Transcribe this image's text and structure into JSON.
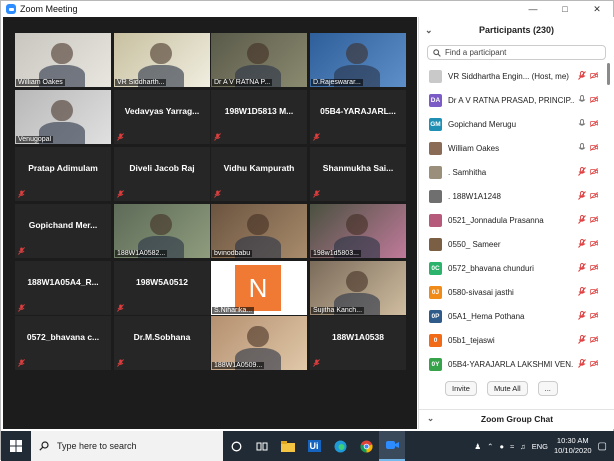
{
  "window": {
    "title": "Zoom Meeting"
  },
  "tiles": [
    {
      "type": "video",
      "label": "William Oakes"
    },
    {
      "type": "video",
      "label": "VR Siddharth..."
    },
    {
      "type": "video",
      "label": "Dr A V RATNA P...",
      "active": true
    },
    {
      "type": "video",
      "label": "D.Rajeswarar..."
    },
    {
      "type": "video",
      "label": "Venugopal"
    },
    {
      "type": "name",
      "name": "Vedavyas Yarrag..."
    },
    {
      "type": "name",
      "name": "198W1D5813 M..."
    },
    {
      "type": "name",
      "name": "05B4-YARAJARL..."
    },
    {
      "type": "name",
      "name": "Pratap Adimulam"
    },
    {
      "type": "name",
      "name": "Diveli Jacob Raj"
    },
    {
      "type": "name",
      "name": "Vidhu Kampurath"
    },
    {
      "type": "name",
      "name": "Shanmukha Sai..."
    },
    {
      "type": "name",
      "name": "Gopichand Mer..."
    },
    {
      "type": "video",
      "label": "188W1A0582..."
    },
    {
      "type": "video",
      "label": "bvinodbabu"
    },
    {
      "type": "video",
      "label": "198w1d5803..."
    },
    {
      "type": "name",
      "name": "188W1A05A4_R..."
    },
    {
      "type": "name",
      "name": "198W5A0512"
    },
    {
      "type": "video",
      "label": "S.Niharika...",
      "letter": "N"
    },
    {
      "type": "video",
      "label": "Sujitha Kanch..."
    },
    {
      "type": "name",
      "name": "0572_bhavana c..."
    },
    {
      "type": "name",
      "name": "Dr.M.Sobhana"
    },
    {
      "type": "video",
      "label": "188W1A0509..."
    },
    {
      "type": "name",
      "name": "188W1A0538"
    }
  ],
  "sidebar": {
    "title": "Participants (230)",
    "search_placeholder": "Find a participant",
    "participants": [
      {
        "name": "VR Siddhartha Engin... (Host, me)",
        "avatar": "photo",
        "color": "#c9c9c9",
        "mic": "muted",
        "video": "off"
      },
      {
        "name": "Dr A V RATNA PRASAD, PRINCIP...",
        "avatar": "DA",
        "color": "#7b5cc6",
        "mic": "on",
        "video": "off"
      },
      {
        "name": "Gopichand Merugu",
        "avatar": "GM",
        "color": "#1f8fb3",
        "mic": "on",
        "video": "off"
      },
      {
        "name": "William Oakes",
        "avatar": "photo",
        "color": "#8a6b55",
        "mic": "on",
        "video": "off"
      },
      {
        "name": ". Samhitha",
        "avatar": "photo",
        "color": "#9a8f7a",
        "mic": "muted",
        "video": "off"
      },
      {
        "name": ". 188W1A1248",
        "avatar": "photo",
        "color": "#6f6f6f",
        "mic": "muted",
        "video": "off"
      },
      {
        "name": "0521_Jonnadula Prasanna",
        "avatar": "photo",
        "color": "#b55a7a",
        "mic": "muted",
        "video": "off"
      },
      {
        "name": "0550_ Sameer",
        "avatar": "photo",
        "color": "#7a5f44",
        "mic": "muted",
        "video": "off"
      },
      {
        "name": "0572_bhavana chunduri",
        "avatar": "0C",
        "color": "#2cb36b",
        "mic": "muted",
        "video": "off"
      },
      {
        "name": "0580-sivasai jasthi",
        "avatar": "0J",
        "color": "#f08a18",
        "mic": "muted",
        "video": "off"
      },
      {
        "name": "05A1_Hema Pothana",
        "avatar": "0P",
        "color": "#2f5b8a",
        "mic": "muted",
        "video": "off"
      },
      {
        "name": "05b1_tejaswi",
        "avatar": "0",
        "color": "#f06a18",
        "mic": "muted",
        "video": "off"
      },
      {
        "name": "05B4-YARAJARLA LAKSHMI VEN...",
        "avatar": "0Y",
        "color": "#36a34a",
        "mic": "muted",
        "video": "off"
      }
    ],
    "invite": "Invite",
    "mute_all": "Mute All",
    "more": "...",
    "chat_title": "Zoom Group Chat"
  },
  "taskbar": {
    "search_placeholder": "Type here to search",
    "ai_label": "Ui",
    "lang": "ENG",
    "time": "10:30 AM",
    "date": "10/10/2020"
  }
}
